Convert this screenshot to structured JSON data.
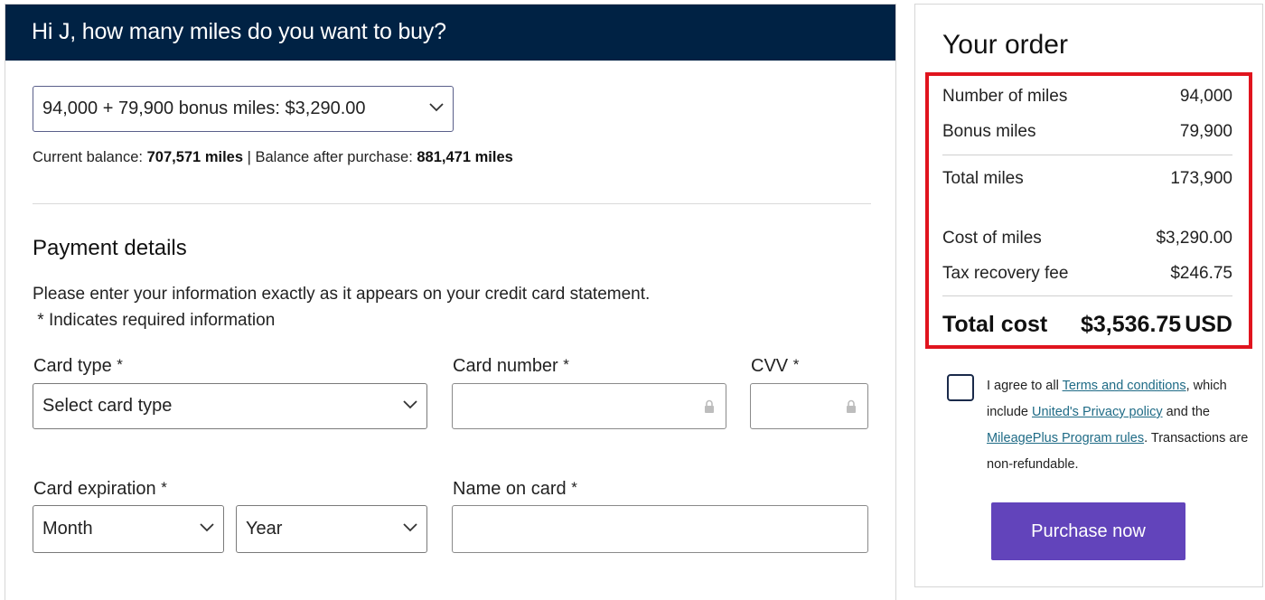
{
  "header": {
    "title": "Hi J, how many miles do you want to buy?"
  },
  "miles_select": {
    "value": "94,000 + 79,900 bonus miles: $3,290.00"
  },
  "balance": {
    "current_label": "Current balance:",
    "current_value": "707,571 miles",
    "separator": "|",
    "after_label": "Balance after purchase:",
    "after_value": "881,471 miles"
  },
  "payment": {
    "title": "Payment details",
    "instructions": "Please enter your information exactly as it appears on your credit card statement.",
    "required_note": " * Indicates required information",
    "required_mark": "*",
    "card_type_label": "Card type",
    "card_type_value": "Select card type",
    "card_number_label": "Card number",
    "cvv_label": "CVV",
    "expiration_label": "Card expiration",
    "month_value": "Month",
    "year_value": "Year",
    "name_label": "Name on card"
  },
  "order": {
    "title": "Your order",
    "rows": [
      {
        "label": "Number of miles",
        "value": "94,000"
      },
      {
        "label": "Bonus miles",
        "value": "79,900"
      },
      {
        "label": "Total miles",
        "value": "173,900"
      },
      {
        "label": "Cost of miles",
        "value": "$3,290.00"
      },
      {
        "label": "Tax recovery fee",
        "value": "$246.75"
      }
    ],
    "total_label": "Total cost",
    "total_value": "$3,536.75",
    "total_currency": "USD"
  },
  "agreement": {
    "text1": "I agree to all ",
    "terms_link": "Terms and conditions",
    "text2": ", which include ",
    "privacy_link": "United's Privacy policy",
    "text3": " and the ",
    "rules_link": "MileagePlus Program rules",
    "text4": ". Transactions are non-refundable."
  },
  "purchase_button": "Purchase now",
  "colors": {
    "header_bg": "#002244",
    "highlight_border": "#e0141e",
    "button_bg": "#6244bb",
    "link": "#1f6b86"
  },
  "icons": [
    "chevron-down-icon",
    "lock-icon"
  ]
}
